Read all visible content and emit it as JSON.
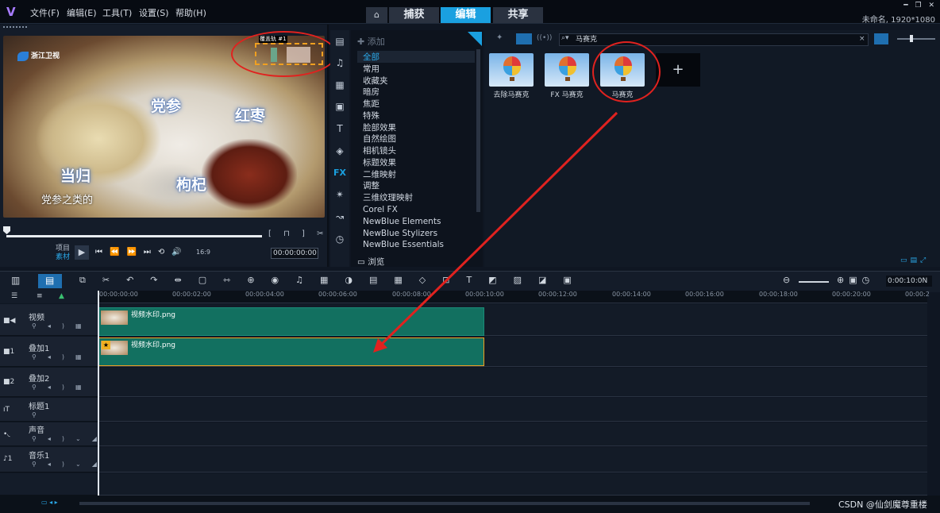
{
  "app": {
    "title_info": "未命名, 1920*1080",
    "menu": [
      "文件(F)",
      "编辑(E)",
      "工具(T)",
      "设置(S)",
      "帮助(H)"
    ],
    "nav_tabs": [
      "捕获",
      "编辑",
      "共享"
    ],
    "active_tab": "编辑"
  },
  "player": {
    "channel_logo": "浙江卫视",
    "labels": [
      "党参",
      "红枣",
      "当归",
      "枸杞"
    ],
    "subtitle": "党参之类的",
    "overlay_tag": "覆盖轨 #1",
    "project_label": "项目",
    "clip_label": "素材",
    "ratio": "16:9",
    "timecode": "00:00:00:00"
  },
  "library": {
    "add_label": "添加",
    "categories": [
      "全部",
      "常用",
      "收藏夹",
      "暗房",
      "焦距",
      "特殊",
      "脸部效果",
      "自然绘图",
      "相机镜头",
      "标题效果",
      "二维映射",
      "调整",
      "三维纹理映射",
      "Corel FX",
      "NewBlue Elements",
      "NewBlue Stylizers",
      "NewBlue Essentials"
    ],
    "selected_category": "全部",
    "browse_label": "浏览",
    "search_value": "马赛克",
    "effects": [
      "去除马赛克",
      "FX 马赛克",
      "马赛克"
    ],
    "add_effect_symbol": "+"
  },
  "timeline": {
    "time_readout": "0:00:10:0N",
    "ruler_ticks": [
      "00:00:00:00",
      "00:00:02:00",
      "00:00:04:00",
      "00:00:06:00",
      "00:00:08:00",
      "00:00:10:00",
      "00:00:12:00",
      "00:00:14:00",
      "00:00:16:00",
      "00:00:18:00",
      "00:00:20:00",
      "00:00:2"
    ],
    "tracks": [
      "视频",
      "叠加1",
      "叠加2",
      "标题1",
      "声音",
      "音乐1"
    ],
    "clips": [
      {
        "track": "视频",
        "name": "视频水印.png"
      },
      {
        "track": "叠加1",
        "name": "视频水印.png"
      }
    ]
  },
  "watermark": "CSDN @仙剑魔尊重楼",
  "colors": {
    "accent": "#1aa0e0",
    "clip": "#127060",
    "highlight": "#e0221f",
    "selection": "#f0a020"
  }
}
